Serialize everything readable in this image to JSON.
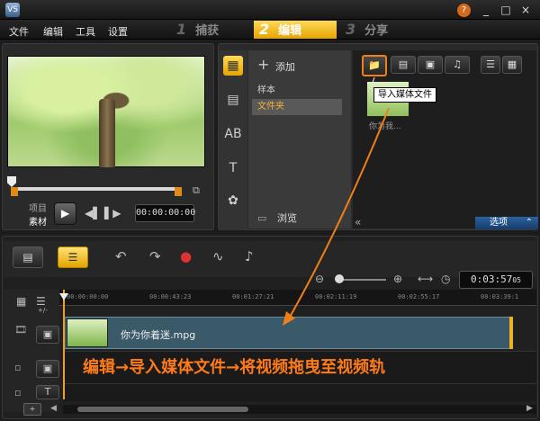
{
  "window": {
    "logo": "app-logo",
    "help_icon": "O",
    "minimize": "_",
    "maximize": "□",
    "close": "×"
  },
  "menu": [
    "文件",
    "编辑",
    "工具",
    "设置"
  ],
  "steps": [
    {
      "num": "1",
      "label": "捕获"
    },
    {
      "num": "2",
      "label": "编辑"
    },
    {
      "num": "3",
      "label": "分享"
    }
  ],
  "preview": {
    "project_label": "项目",
    "clip_label": "素材",
    "timecode": "00:00:00:00"
  },
  "library": {
    "add_label": "添加",
    "list_items": [
      "样本",
      "文件夹"
    ],
    "browse_label": "浏览",
    "tooltip": "导入媒体文件",
    "thumb_label": "你为我...",
    "options_label": "选项"
  },
  "timeline": {
    "duration": "0:03:57",
    "duration_frames": "05",
    "ruler_ticks": [
      "00:00:00:00",
      "00:00:43:23",
      "00:01:27:21",
      "00:02:11:19",
      "00:02:55:17",
      "00:03:39:1"
    ],
    "clip_name": "你为你着迷.mpg",
    "add_track_label": "+/-"
  },
  "instruction": "编辑→导入媒体文件→将视频拖曳至视频轨",
  "colors": {
    "accent": "#f07f18",
    "active_tab": "#f2b800",
    "options_blue": "#1e4f86"
  }
}
